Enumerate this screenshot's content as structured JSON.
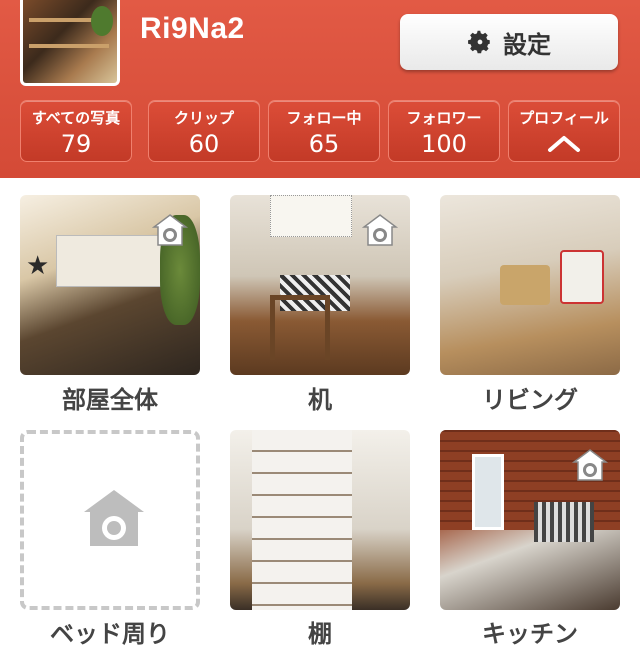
{
  "profile": {
    "username": "Ri9Na2",
    "settings_label": "設定",
    "settings_icon": "gear-icon"
  },
  "stats": [
    {
      "label": "すべての写真",
      "value": "79"
    },
    {
      "label": "クリップ",
      "value": "60"
    },
    {
      "label": "フォロー中",
      "value": "65"
    },
    {
      "label": "フォロワー",
      "value": "100"
    },
    {
      "label": "プロフィール",
      "icon": "chevron-up-icon"
    }
  ],
  "rooms": [
    {
      "label": "部屋全体",
      "has_photo": true
    },
    {
      "label": "机",
      "has_photo": true
    },
    {
      "label": "リビング",
      "has_photo": true
    },
    {
      "label": "ベッド周り",
      "has_photo": false
    },
    {
      "label": "棚",
      "has_photo": true
    },
    {
      "label": "キッチン",
      "has_photo": true
    }
  ],
  "colors": {
    "header_bg": "#d9503c",
    "stat_button_bg": "#c9402d",
    "label_text": "#444444",
    "empty_border": "#c8c8c8"
  }
}
